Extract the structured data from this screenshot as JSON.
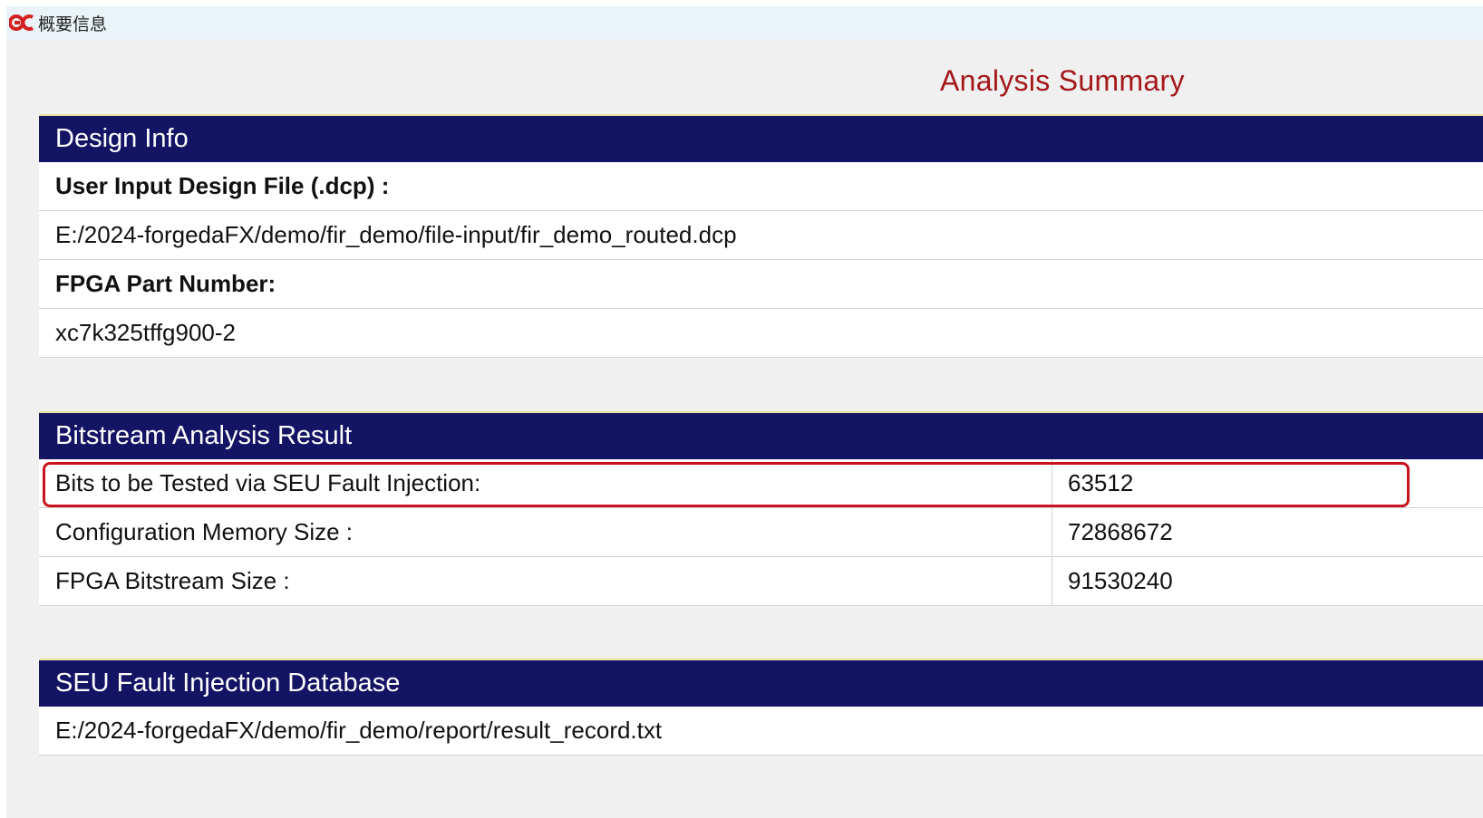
{
  "window": {
    "title": "概要信息"
  },
  "page": {
    "title": "Analysis Summary"
  },
  "design_info": {
    "header": "Design Info",
    "rows": [
      {
        "text": "User Input Design File (.dcp) :",
        "bold": true
      },
      {
        "text": "E:/2024-forgedaFX/demo/fir_demo/file-input/fir_demo_routed.dcp",
        "bold": false
      },
      {
        "text": "FPGA Part Number:",
        "bold": true
      },
      {
        "text": "xc7k325tffg900-2",
        "bold": false
      }
    ]
  },
  "bitstream": {
    "header": "Bitstream Analysis Result",
    "rows": [
      {
        "label": "Bits to be Tested via SEU Fault Injection:",
        "value": "63512"
      },
      {
        "label": "Configuration Memory Size :",
        "value": "72868672"
      },
      {
        "label": "FPGA Bitstream Size :",
        "value": "91530240"
      }
    ]
  },
  "database": {
    "header": "SEU Fault Injection Database",
    "path": "E:/2024-forgedaFX/demo/fir_demo/report/result_record.txt"
  },
  "colors": {
    "header_bg": "#141464",
    "title_red": "#a4161a",
    "highlight": "#c8141e"
  },
  "icons": {
    "logo": "forgeda-logo-icon"
  }
}
